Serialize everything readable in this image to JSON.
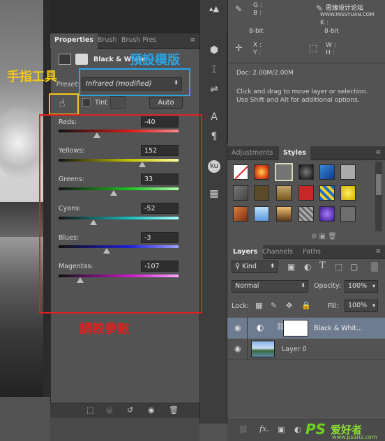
{
  "properties_panel": {
    "tabs": [
      "Properties",
      "Brush",
      "Brush Pres"
    ],
    "adjustment_title": "Black & White",
    "preset_label": "Preset:",
    "preset_value": "Infrared (modified)",
    "tint_label": "Tint",
    "auto_label": "Auto",
    "sliders": [
      {
        "label": "Reds:",
        "value": "-40",
        "position": 0.32
      },
      {
        "label": "Yellows:",
        "value": "152",
        "position": 0.7
      },
      {
        "label": "Greens:",
        "value": "33",
        "position": 0.46
      },
      {
        "label": "Cyans:",
        "value": "-52",
        "position": 0.29
      },
      {
        "label": "Blues:",
        "value": "-3",
        "position": 0.4
      },
      {
        "label": "Magentas:",
        "value": "-107",
        "position": 0.18
      }
    ]
  },
  "annotations": {
    "finger_tool": "手指工具",
    "preset_mode": "預設模版",
    "adjust_params": "調較參數"
  },
  "info_panel": {
    "row1_left": "G :\nB :",
    "row1_right_top": "Y :",
    "row1_right_bottom": "K :",
    "bit_left": "8-bit",
    "bit_right": "8-bit",
    "x_label": "X :",
    "y_label": "Y :",
    "w_label": "W :",
    "h_label": "H :",
    "doc": "Doc: 2.00M/2.00M",
    "hint_line1": "Click and drag to move layer or selection.",
    "hint_line2": "Use Shift and Alt for additional options.",
    "watermark_top": "思缘设计论坛",
    "watermark_url": "WWW.MISSYUAN.COM"
  },
  "styles_panel": {
    "tabs": [
      "Adjustments",
      "Styles"
    ]
  },
  "layers_panel": {
    "tabs": [
      "Layers",
      "Channels",
      "Paths"
    ],
    "filter_kind": "Kind",
    "blend_mode": "Normal",
    "opacity_label": "Opacity:",
    "opacity_value": "100%",
    "lock_label": "Lock:",
    "fill_label": "Fill:",
    "fill_value": "100%",
    "layers": [
      {
        "name": "Black & Whit..."
      },
      {
        "name": "Layer 0"
      }
    ]
  },
  "watermark": {
    "ps_logo": "PS",
    "ps_text": "爱好者",
    "url": "www.psahz.com"
  },
  "colors": {
    "annot_yellow": "#f2c81a",
    "annot_blue": "#2aa6e8",
    "annot_red": "#e02020"
  }
}
